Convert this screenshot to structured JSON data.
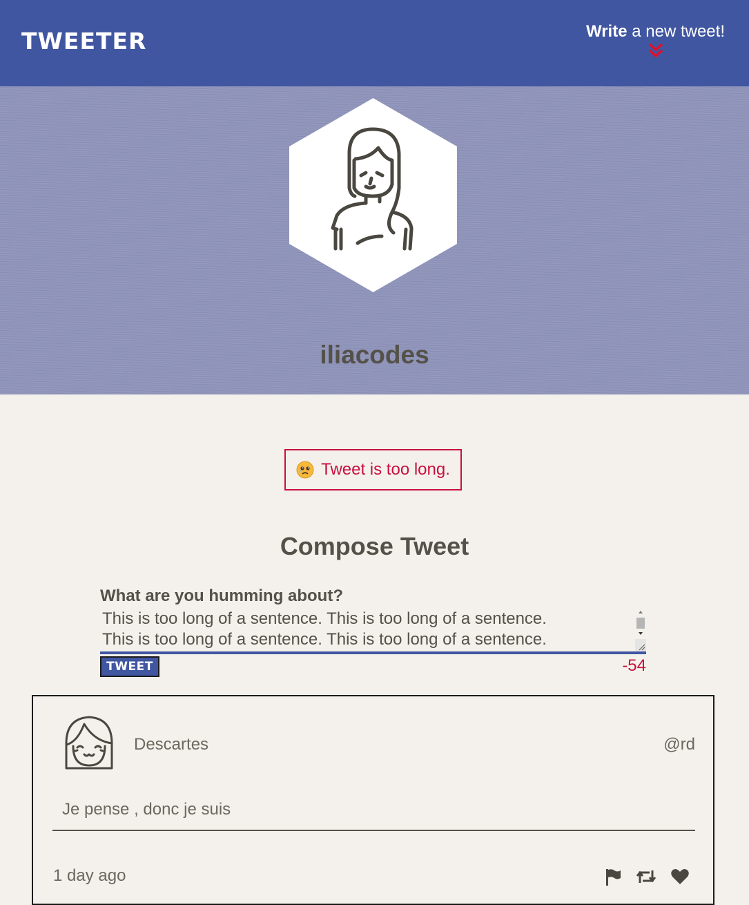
{
  "nav": {
    "brand": "TWEETER",
    "write_bold": "Write",
    "write_rest": " a new tweet!"
  },
  "header": {
    "username": "iliacodes"
  },
  "error": {
    "message": "Tweet is too long."
  },
  "compose": {
    "title": "Compose Tweet",
    "label": "What are you humming about?",
    "text_lines": [
      "This is too long of a sentence. This is too long of a sentence.",
      "This is too long of a sentence. This is too long of a sentence."
    ],
    "button_label": "TWEET",
    "counter": "-54"
  },
  "tweet": {
    "name": "Descartes",
    "handle": "@rd",
    "content": "Je pense , donc je suis",
    "timestamp": "1 day ago"
  },
  "colors": {
    "nav": "#4056a1",
    "header": "#8f94ba",
    "page": "#f4f1ec",
    "text": "#545149",
    "error": "#c8103e"
  },
  "icons": [
    "double-chevron-down-icon",
    "sad-face-icon",
    "flag-icon",
    "retweet-icon",
    "heart-icon"
  ]
}
